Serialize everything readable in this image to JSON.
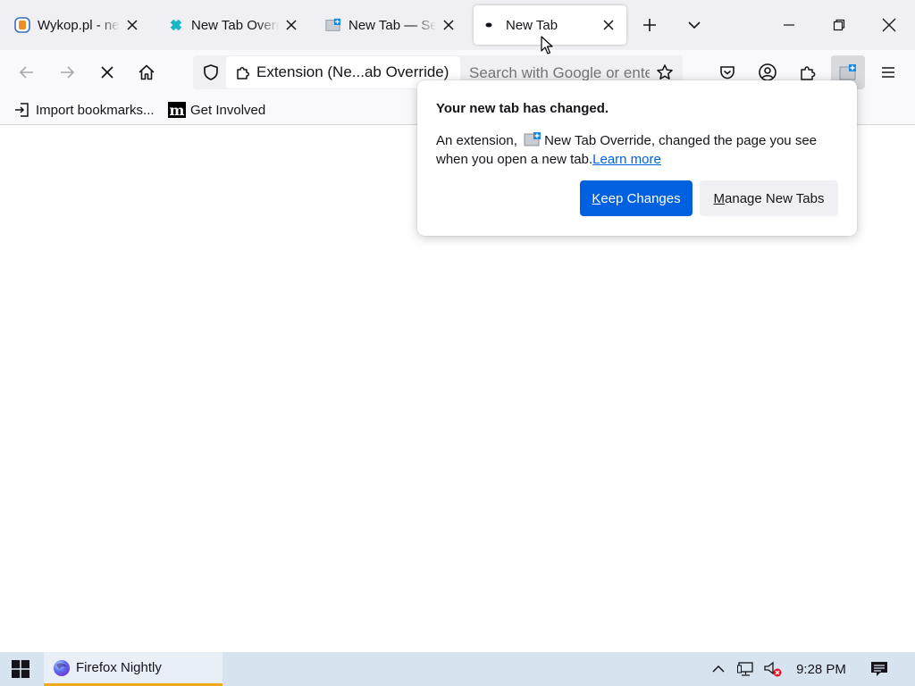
{
  "tabs": [
    {
      "title": "Wykop.pl - newsy",
      "favicon": "wykop-icon",
      "selected": false
    },
    {
      "title": "New Tab Override",
      "favicon": "puzzle-icon",
      "selected": false
    },
    {
      "title": "New Tab — Settings",
      "favicon": "new-tab-override-icon",
      "selected": false
    },
    {
      "title": "New Tab",
      "favicon": "loading-dot-icon",
      "selected": true
    }
  ],
  "navbar": {
    "identity_label": "Extension (Ne...ab Override)",
    "search_placeholder": "Search with Google or enter address"
  },
  "bookmarks": [
    {
      "label": "Import bookmarks...",
      "icon": "import-icon"
    },
    {
      "label": "Get Involved",
      "icon": "mozilla-m-icon"
    }
  ],
  "panel": {
    "heading": "Your new tab has changed.",
    "body_prefix": "An extension,",
    "extension_name": "New Tab Override, changed the page you see when you open a new tab.",
    "learn_more": "Learn more",
    "keep_label": "Keep Changes",
    "keep_access_key": "K",
    "keep_rest": "eep Changes",
    "manage_access_key": "M",
    "manage_rest": "anage New Tabs"
  },
  "taskbar": {
    "app_label": "Firefox Nightly",
    "clock": "9:28 PM"
  },
  "colors": {
    "accent": "#0061e0",
    "tabstrip": "#f0f0f4",
    "taskbar": "#d7e4ef",
    "active_task_underline": "#f0a81e"
  }
}
